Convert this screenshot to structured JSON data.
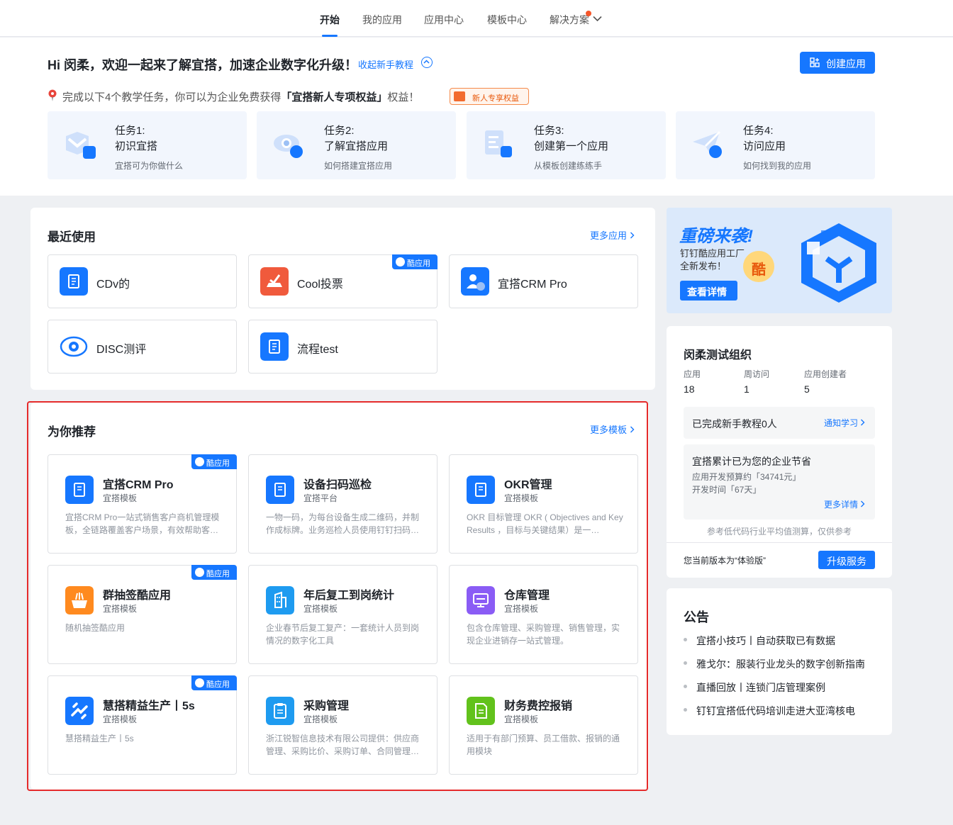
{
  "nav": {
    "items": [
      "开始",
      "我的应用",
      "应用中心",
      "模板中心",
      "解决方案"
    ]
  },
  "hero": {
    "greeting": "Hi 闵柔，欢迎一起来了解宜搭，加速企业数字化升级！",
    "tutorial_link": "收起新手教程",
    "create_button": "创建应用",
    "task_intro_pre": "完成以下4个教学任务，你可以为企业免费获得",
    "task_intro_bold": "「宜搭新人专项权益」",
    "task_intro_post": "权益！",
    "benefit_badge": "新人专享权益",
    "tasks": [
      {
        "num": "任务1:",
        "title": "初识宜搭",
        "desc": "宜搭可为你做什么"
      },
      {
        "num": "任务2:",
        "title": "了解宜搭应用",
        "desc": "如何搭建宜搭应用"
      },
      {
        "num": "任务3:",
        "title": "创建第一个应用",
        "desc": "从模板创建练练手"
      },
      {
        "num": "任务4:",
        "title": "访问应用",
        "desc": "如何找到我的应用"
      }
    ]
  },
  "recent": {
    "title": "最近使用",
    "more": "更多应用",
    "ribbon": "酷应用",
    "apps": [
      {
        "name": "CDv的"
      },
      {
        "name": "Cool投票"
      },
      {
        "name": "宜搭CRM Pro"
      },
      {
        "name": "DISC测评"
      },
      {
        "name": "流程test"
      }
    ]
  },
  "recommend": {
    "title": "为你推荐",
    "more": "更多模板",
    "ribbon": "酷应用",
    "cards": [
      {
        "name": "宜搭CRM Pro",
        "sub": "宜搭模板",
        "desc": "宜搭CRM Pro一站式销售客户商机管理模板，全链路覆盖客户场景，有效帮助客…"
      },
      {
        "name": "设备扫码巡检",
        "sub": "宜搭平台",
        "desc": "一物一码，为每台设备生成二维码，并制作成标牌。业务巡检人员使用钉钉扫码…"
      },
      {
        "name": "OKR管理",
        "sub": "宜搭模板",
        "desc": "OKR 目标管理 OKR ( Objectives and Key Results ，目标与关键结果）是一…"
      },
      {
        "name": "群抽签酷应用",
        "sub": "宜搭模板",
        "desc": "随机抽签酷应用"
      },
      {
        "name": "年后复工到岗统计",
        "sub": "宜搭模板",
        "desc": "企业春节后复工复产：一套统计人员到岗情况的数字化工具"
      },
      {
        "name": "仓库管理",
        "sub": "宜搭模板",
        "desc": "包含仓库管理、采购管理、销售管理，实现企业进销存一站式管理。"
      },
      {
        "name": "慧搭精益生产丨5s",
        "sub": "宜搭模板",
        "desc": "慧搭精益生产丨5s"
      },
      {
        "name": "采购管理",
        "sub": "宜搭模板",
        "desc": "浙江锐智信息技术有限公司提供：供应商管理、采购比价、采购订单、合同管理…"
      },
      {
        "name": "财务费控报销",
        "sub": "宜搭模板",
        "desc": "适用于有部门预算、员工借款、报销的通用模块"
      }
    ]
  },
  "banner": {
    "headline": "重磅来袭!",
    "line1": "钉钉酷应用工厂",
    "line2": "全新发布！",
    "button": "查看详情",
    "badge": "酷"
  },
  "org": {
    "title": "闵柔测试组织",
    "stats": [
      {
        "label": "应用",
        "value": "18"
      },
      {
        "label": "周访问",
        "value": "1"
      },
      {
        "label": "应用创建者",
        "value": "5"
      }
    ],
    "completed": "已完成新手教程0人",
    "notify": "通知学习",
    "savings_title": "宜搭累计已为您的企业节省",
    "savings_budget": "应用开发预算约「34741元」",
    "savings_time": "开发时间「67天」",
    "more_detail": "更多详情",
    "note": "参考低代码行业平均值测算，仅供参考",
    "version": "您当前版本为“体验版”",
    "upgrade": "升级服务"
  },
  "notice": {
    "title": "公告",
    "items": [
      "宜搭小技巧丨自动获取已有数据",
      "雅戈尔：服装行业龙头的数字创新指南",
      "直播回放丨连锁门店管理案例",
      "钉钉宜搭低代码培训走进大亚湾核电"
    ]
  },
  "colors": {
    "accent": "#1677ff",
    "ribbon": "#1677ff",
    "highlight_border": "#e52b2b"
  }
}
